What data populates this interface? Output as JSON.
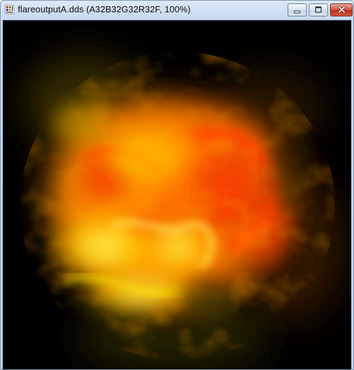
{
  "window": {
    "title": "flareoutputA.dds (A32B32G32R32F, 100%)",
    "app_icon": "dds-texture-icon"
  },
  "controls": {
    "minimize": "minimize-icon",
    "maximize": "maximize-icon",
    "close": "close-icon"
  },
  "viewer": {
    "image": "fiery orange-yellow flare texture on black background",
    "colors": {
      "background": "#000000",
      "core_orange": "#ff7a00",
      "hot_red": "#ff3c00",
      "yellow": "#ffe100",
      "dark_edge": "#3a2a00"
    }
  }
}
